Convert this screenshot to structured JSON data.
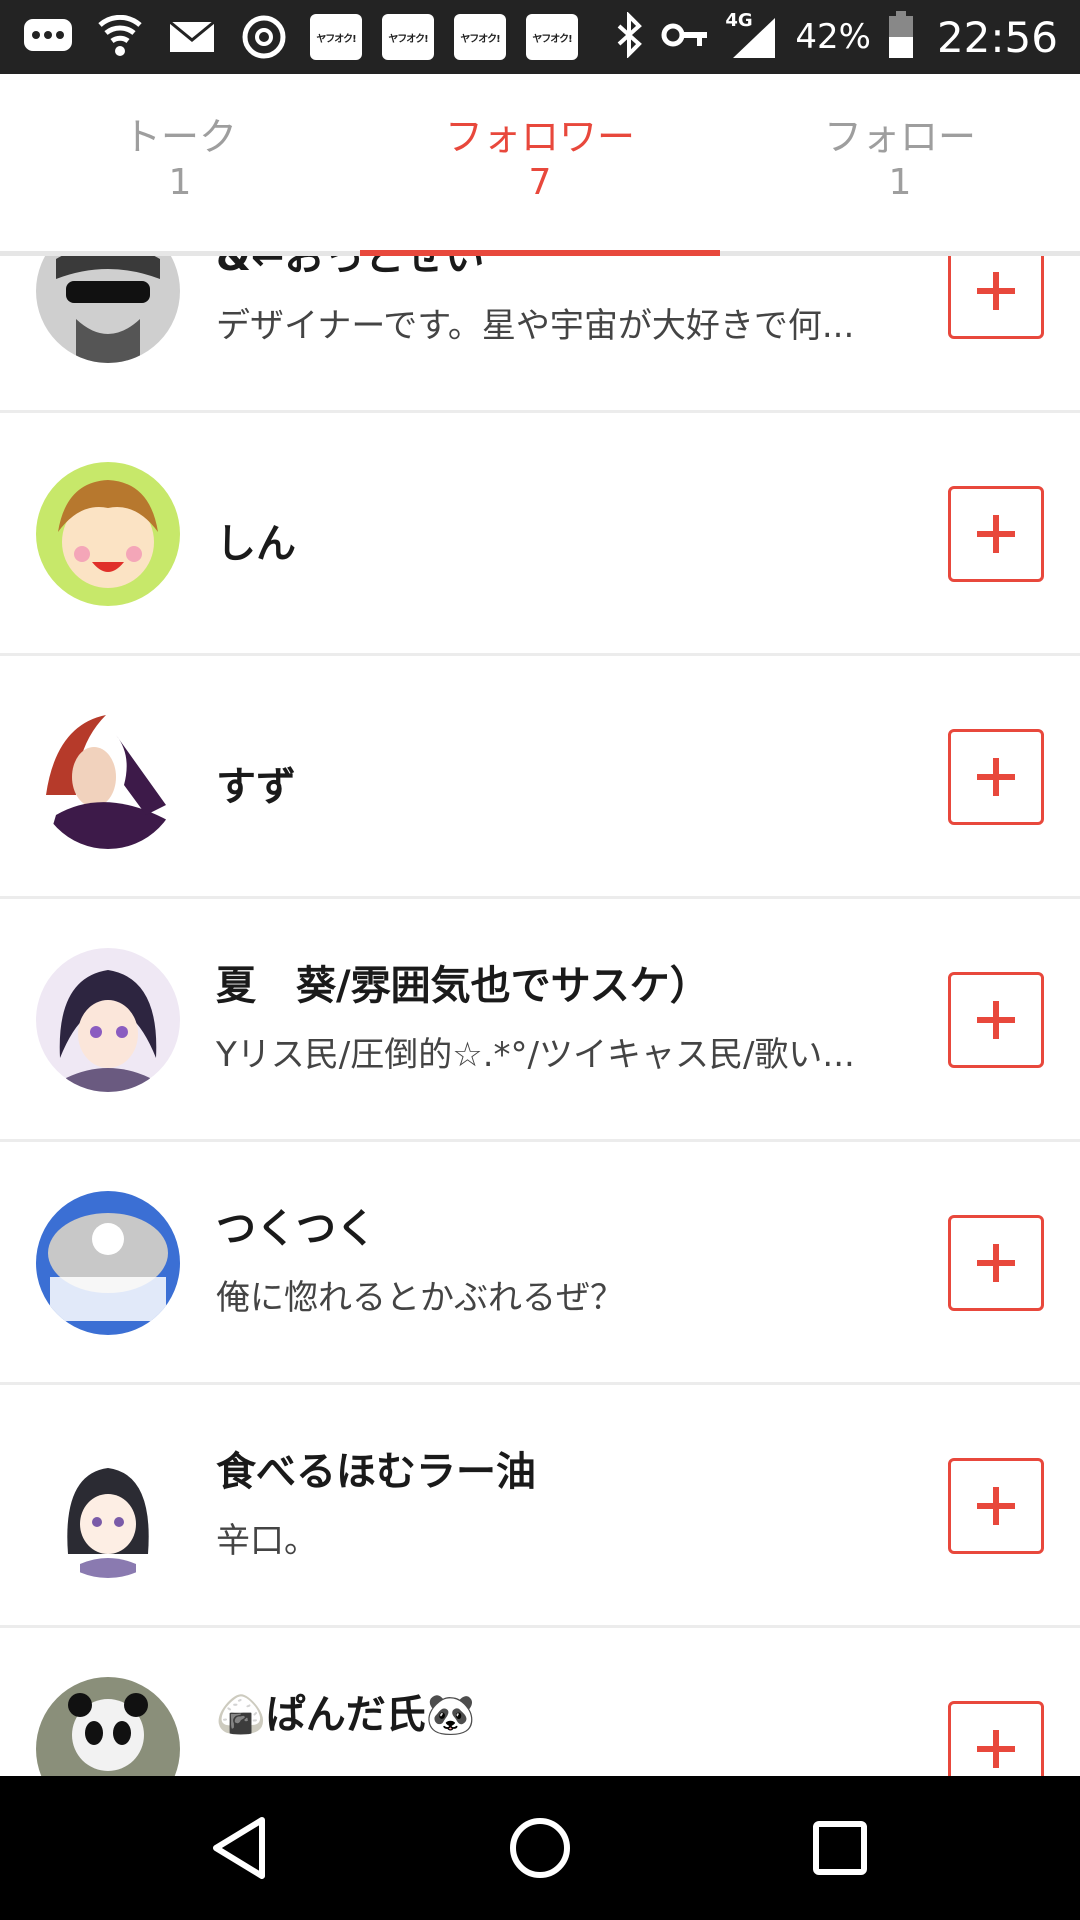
{
  "status_bar": {
    "left_icons": [
      "chat-bubble-icon",
      "wifi-icon",
      "mail-icon",
      "chrome-icon",
      "yahoo-auction-icon",
      "yahoo-auction-icon",
      "yahoo-auction-icon",
      "yahoo-auction-icon"
    ],
    "yahoo_badge_text": "ヤフオク!",
    "network": "4G",
    "battery": "42%",
    "time": "22:56"
  },
  "tabs": [
    {
      "label": "トーク",
      "count": "1",
      "active": false
    },
    {
      "label": "フォロワー",
      "count": "7",
      "active": true
    },
    {
      "label": "フォロー",
      "count": "1",
      "active": false
    }
  ],
  "followers": [
    {
      "name": "&←おっとせい",
      "bio": "デザイナーです。星や宇宙が大好きで何..."
    },
    {
      "name": "しん",
      "bio": ""
    },
    {
      "name": "すず",
      "bio": ""
    },
    {
      "name": "夏　葵/雰囲気也でサスケ）",
      "bio": "Yリス民/圧倒的☆.*°/ツイキャス民/歌い..."
    },
    {
      "name": "つくつく",
      "bio": "俺に惚れるとかぶれるぜ？"
    },
    {
      "name": "食べるほむラー油",
      "bio": "辛口。"
    },
    {
      "name": "🍙ぱんだ氏🐼",
      "bio": ""
    }
  ],
  "colors": {
    "accent": "#e8483c",
    "status_bar": "#232323",
    "nav_bar": "#000000"
  }
}
